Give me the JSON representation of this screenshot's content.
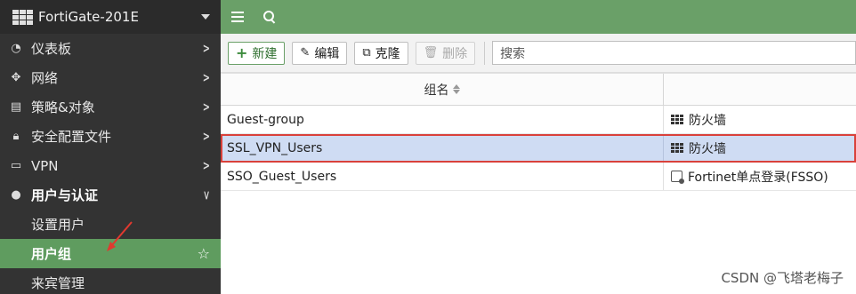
{
  "app": {
    "title": "FortiGate-201E"
  },
  "sidebar": {
    "items": [
      {
        "label": "仪表板",
        "icon": "dashboard-icon"
      },
      {
        "label": "网络",
        "icon": "network-move-icon"
      },
      {
        "label": "策略&对象",
        "icon": "policy-icon"
      },
      {
        "label": "安全配置文件",
        "icon": "lock-icon"
      },
      {
        "label": "VPN",
        "icon": "laptop-icon"
      },
      {
        "label": "用户与认证",
        "icon": "user-icon"
      }
    ],
    "subitems": [
      {
        "label": "设置用户"
      },
      {
        "label": "用户组"
      },
      {
        "label": "来宾管理"
      }
    ]
  },
  "toolbar": {
    "new_label": "新建",
    "edit_label": "编辑",
    "clone_label": "克隆",
    "delete_label": "删除",
    "search_placeholder": "搜索"
  },
  "table": {
    "header": "组名",
    "rows": [
      {
        "name": "Guest-group",
        "type": "防火墙"
      },
      {
        "name": "SSL_VPN_Users",
        "type": "防火墙"
      },
      {
        "name": "SSO_Guest_Users",
        "type": "Fortinet单点登录(FSSO)"
      }
    ]
  },
  "watermark": "CSDN @飞塔老梅子",
  "colors": {
    "accent": "#6aa068",
    "sidebar": "#333333",
    "selected_row": "#cfdcf3",
    "highlight_border": "#d9413b",
    "annotation_arrow": "#e0392f"
  }
}
